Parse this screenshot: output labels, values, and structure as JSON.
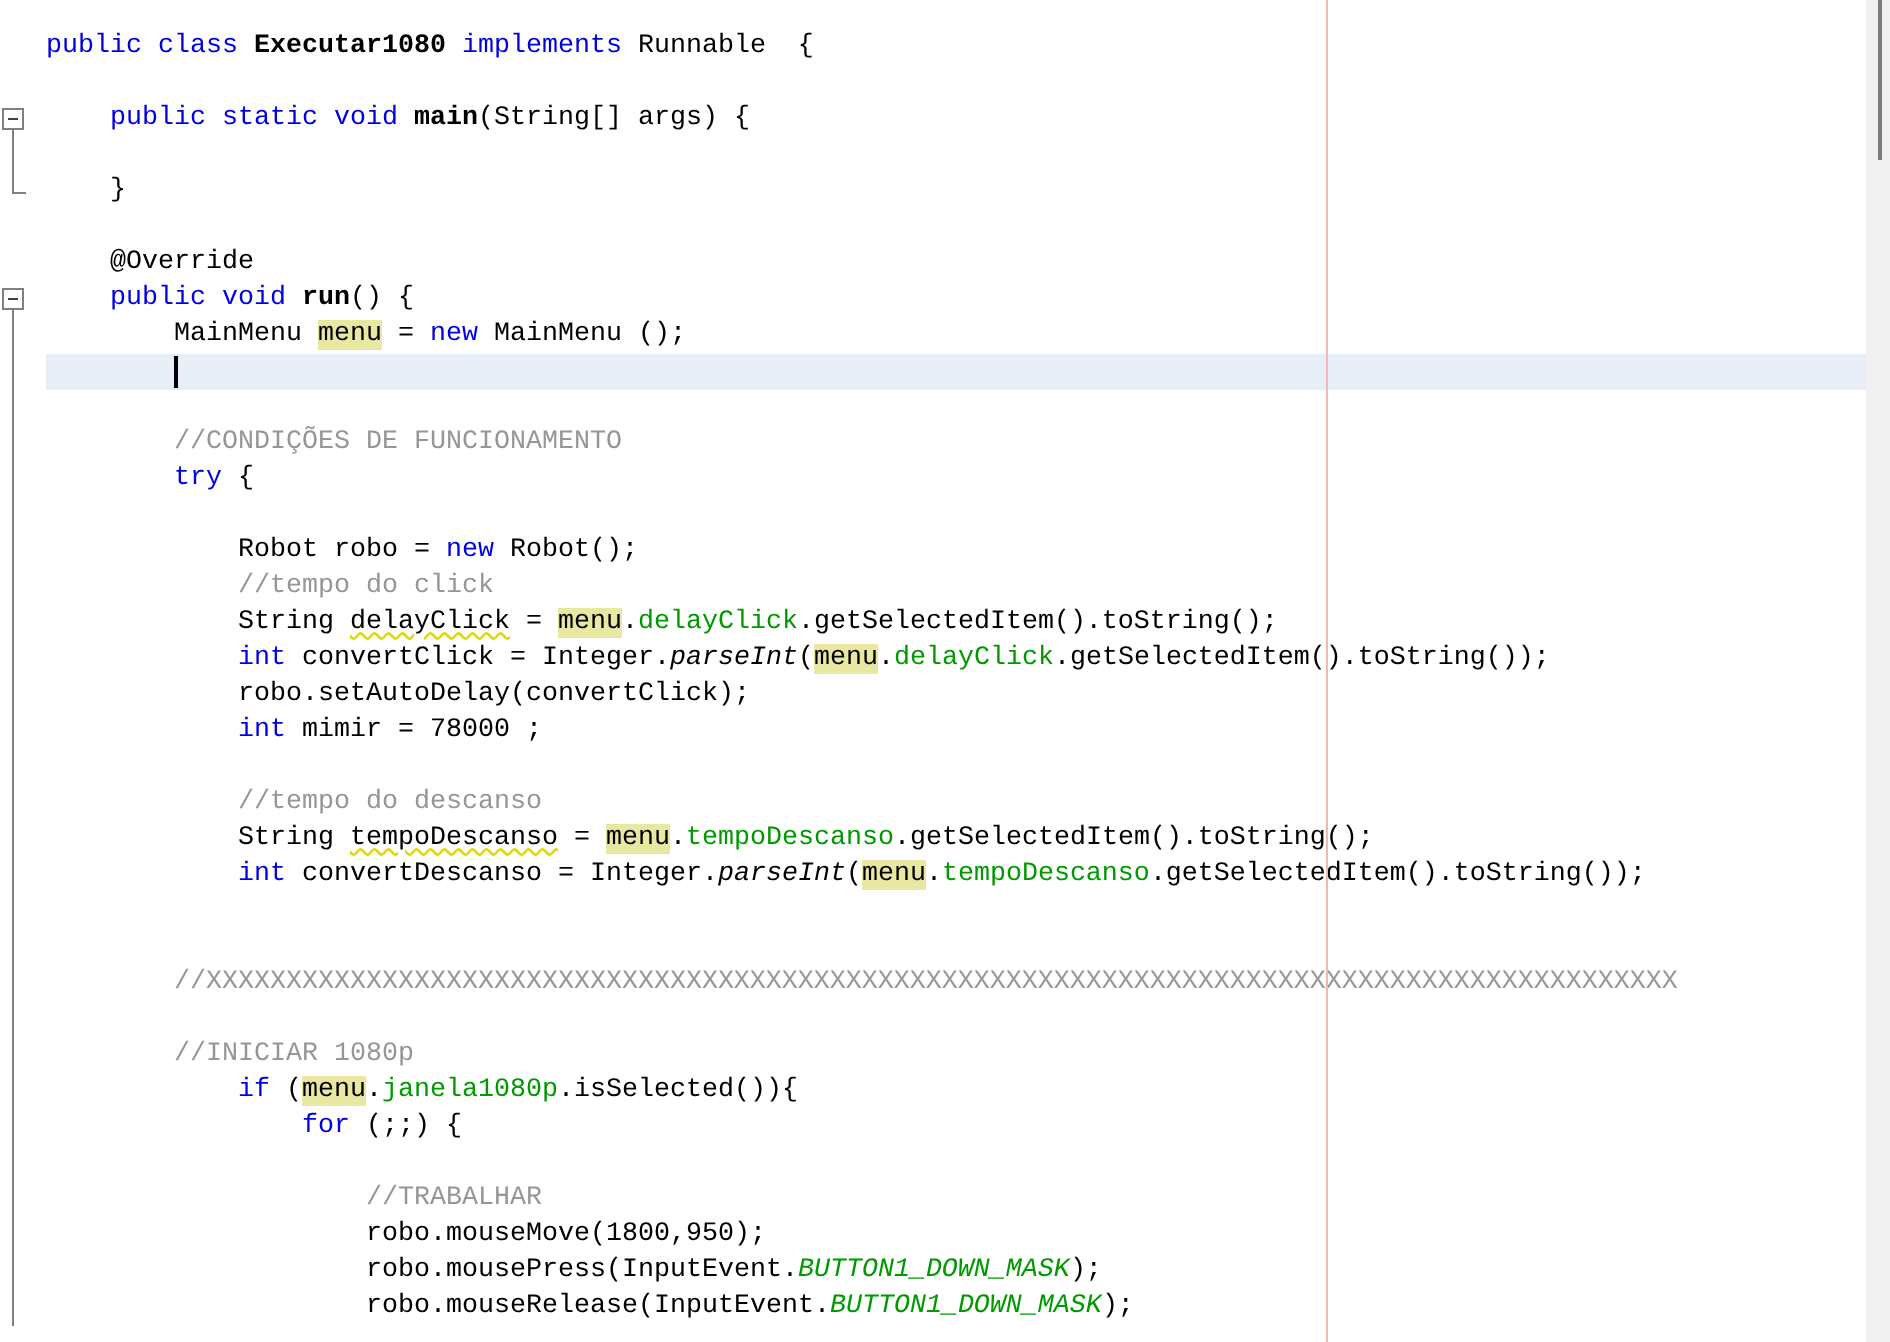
{
  "editor": {
    "lines": [
      {
        "kind": "code",
        "tokens": [
          {
            "kind": "keyword",
            "text": "public class "
          },
          {
            "kind": "bold",
            "text": "Executar1080"
          },
          {
            "kind": "keyword",
            "text": " implements "
          },
          {
            "kind": "plain",
            "text": "Runnable  {"
          }
        ],
        "children": [
          {
            "kind": "blank"
          },
          {
            "kind": "code",
            "expanded": true,
            "tokens": [
              {
                "kind": "keyword",
                "text": "public static void "
              },
              {
                "kind": "bold",
                "text": "main"
              },
              {
                "kind": "plain",
                "text": "(String[] args) {"
              }
            ],
            "children": [
              {
                "kind": "blank"
              }
            ]
          },
          {
            "kind": "code",
            "fold_end": true,
            "tokens": [
              {
                "kind": "plain",
                "text": "}"
              }
            ]
          },
          {
            "kind": "blank"
          },
          {
            "kind": "code",
            "tokens": [
              {
                "kind": "plain",
                "text": "@Override"
              }
            ]
          },
          {
            "kind": "code",
            "expanded": true,
            "tokens": [
              {
                "kind": "keyword",
                "text": "public void "
              },
              {
                "kind": "bold",
                "text": "run"
              },
              {
                "kind": "plain",
                "text": "() {"
              }
            ],
            "children": [
              {
                "kind": "code",
                "tokens": [
                  {
                    "kind": "plain",
                    "text": "MainMenu "
                  },
                  {
                    "kind": "occurrence",
                    "text": "menu"
                  },
                  {
                    "kind": "plain",
                    "text": " = "
                  },
                  {
                    "kind": "keyword",
                    "text": "new"
                  },
                  {
                    "kind": "plain",
                    "text": " MainMenu ();"
                  }
                ]
              },
              {
                "kind": "blank",
                "current": true
              },
              {
                "kind": "blank"
              },
              {
                "kind": "code",
                "tokens": [
                  {
                    "kind": "comment",
                    "text": "//CONDIÇÕES DE FUNCIONAMENTO"
                  }
                ]
              },
              {
                "kind": "code",
                "tokens": [
                  {
                    "kind": "keyword",
                    "text": "try"
                  },
                  {
                    "kind": "plain",
                    "text": " {"
                  }
                ],
                "children": [
                  {
                    "kind": "blank"
                  },
                  {
                    "kind": "code",
                    "tokens": [
                      {
                        "kind": "plain",
                        "text": "Robot robo = "
                      },
                      {
                        "kind": "keyword",
                        "text": "new"
                      },
                      {
                        "kind": "plain",
                        "text": " Robot();"
                      }
                    ]
                  },
                  {
                    "kind": "code",
                    "tokens": [
                      {
                        "kind": "comment",
                        "text": "//tempo do click"
                      }
                    ]
                  },
                  {
                    "kind": "code",
                    "tokens": [
                      {
                        "kind": "plain",
                        "text": "String "
                      },
                      {
                        "kind": "warning",
                        "text": "delayClick"
                      },
                      {
                        "kind": "plain",
                        "text": " = "
                      },
                      {
                        "kind": "occurrence",
                        "text": "menu"
                      },
                      {
                        "kind": "plain",
                        "text": "."
                      },
                      {
                        "kind": "field",
                        "text": "delayClick"
                      },
                      {
                        "kind": "plain",
                        "text": ".getSelectedItem().toString();"
                      }
                    ]
                  },
                  {
                    "kind": "code",
                    "tokens": [
                      {
                        "kind": "keyword",
                        "text": "int"
                      },
                      {
                        "kind": "plain",
                        "text": " convertClick = Integer."
                      },
                      {
                        "kind": "italic",
                        "text": "parseInt"
                      },
                      {
                        "kind": "plain",
                        "text": "("
                      },
                      {
                        "kind": "occurrence",
                        "text": "menu"
                      },
                      {
                        "kind": "plain",
                        "text": "."
                      },
                      {
                        "kind": "field",
                        "text": "delayClick"
                      },
                      {
                        "kind": "plain",
                        "text": ".getSelectedItem().toString());"
                      }
                    ]
                  },
                  {
                    "kind": "code",
                    "tokens": [
                      {
                        "kind": "plain",
                        "text": "robo.setAutoDelay(convertClick);"
                      }
                    ]
                  },
                  {
                    "kind": "code",
                    "tokens": [
                      {
                        "kind": "keyword",
                        "text": "int"
                      },
                      {
                        "kind": "plain",
                        "text": " mimir = 78000 ;"
                      }
                    ]
                  },
                  {
                    "kind": "blank"
                  },
                  {
                    "kind": "code",
                    "tokens": [
                      {
                        "kind": "comment",
                        "text": "//tempo do descanso"
                      }
                    ]
                  },
                  {
                    "kind": "code",
                    "tokens": [
                      {
                        "kind": "plain",
                        "text": "String "
                      },
                      {
                        "kind": "warning",
                        "text": "tempoDescanso"
                      },
                      {
                        "kind": "plain",
                        "text": " = "
                      },
                      {
                        "kind": "occurrence",
                        "text": "menu"
                      },
                      {
                        "kind": "plain",
                        "text": "."
                      },
                      {
                        "kind": "field",
                        "text": "tempoDescanso"
                      },
                      {
                        "kind": "plain",
                        "text": ".getSelectedItem().toString();"
                      }
                    ]
                  },
                  {
                    "kind": "code",
                    "tokens": [
                      {
                        "kind": "keyword",
                        "text": "int"
                      },
                      {
                        "kind": "plain",
                        "text": " convertDescanso = Integer."
                      },
                      {
                        "kind": "italic",
                        "text": "parseInt"
                      },
                      {
                        "kind": "plain",
                        "text": "("
                      },
                      {
                        "kind": "occurrence",
                        "text": "menu"
                      },
                      {
                        "kind": "plain",
                        "text": "."
                      },
                      {
                        "kind": "field",
                        "text": "tempoDescanso"
                      },
                      {
                        "kind": "plain",
                        "text": ".getSelectedItem().toString());"
                      }
                    ]
                  },
                  {
                    "kind": "blank"
                  },
                  {
                    "kind": "blank"
                  }
                ]
              },
              {
                "kind": "code",
                "tokens": [
                  {
                    "kind": "comment",
                    "text": "//XXXXXXXXXXXXXXXXXXXXXXXXXXXXXXXXXXXXXXXXXXXXXXXXXXXXXXXXXXXXXXXXXXXXXXXXXXXXXXXXXXXXXXXXXXXX"
                  }
                ]
              },
              {
                "kind": "blank"
              },
              {
                "kind": "code",
                "tokens": [
                  {
                    "kind": "comment",
                    "text": "//INICIAR 1080p"
                  }
                ],
                "children": [
                  {
                    "kind": "code",
                    "tokens": [
                      {
                        "kind": "keyword",
                        "text": "if"
                      },
                      {
                        "kind": "plain",
                        "text": " ("
                      },
                      {
                        "kind": "occurrence",
                        "text": "menu"
                      },
                      {
                        "kind": "plain",
                        "text": "."
                      },
                      {
                        "kind": "field",
                        "text": "janela1080p"
                      },
                      {
                        "kind": "plain",
                        "text": ".isSelected()){"
                      }
                    ],
                    "children": [
                      {
                        "kind": "code",
                        "tokens": [
                          {
                            "kind": "keyword",
                            "text": "for"
                          },
                          {
                            "kind": "plain",
                            "text": " (;;) {"
                          }
                        ],
                        "children": [
                          {
                            "kind": "blank"
                          },
                          {
                            "kind": "code",
                            "tokens": [
                              {
                                "kind": "comment",
                                "text": "//TRABALHAR"
                              }
                            ]
                          },
                          {
                            "kind": "code",
                            "tokens": [
                              {
                                "kind": "plain",
                                "text": "robo.mouseMove(1800,950);"
                              }
                            ]
                          },
                          {
                            "kind": "code",
                            "tokens": [
                              {
                                "kind": "plain",
                                "text": "robo.mousePress(InputEvent."
                              },
                              {
                                "kind": "constant",
                                "text": "BUTTON1_DOWN_MASK"
                              },
                              {
                                "kind": "plain",
                                "text": ");"
                              }
                            ]
                          },
                          {
                            "kind": "code",
                            "tokens": [
                              {
                                "kind": "plain",
                                "text": "robo.mouseRelease(InputEvent."
                              },
                              {
                                "kind": "constant",
                                "text": "BUTTON1_DOWN_MASK"
                              },
                              {
                                "kind": "plain",
                                "text": ");"
                              }
                            ]
                          }
                        ]
                      }
                    ]
                  }
                ]
              }
            ]
          }
        ]
      }
    ]
  }
}
